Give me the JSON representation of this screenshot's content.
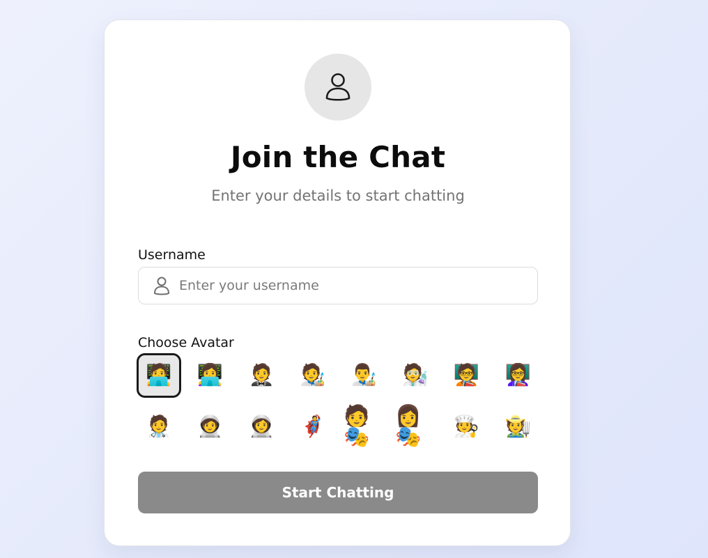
{
  "header": {
    "icon": "user-icon",
    "title": "Join the Chat",
    "subtitle": "Enter your details to start chatting"
  },
  "username": {
    "label": "Username",
    "placeholder": "Enter your username",
    "value": "",
    "icon": "user-icon"
  },
  "avatar_picker": {
    "label": "Choose Avatar",
    "selected_index": 0,
    "avatars": [
      "🧑‍💻",
      "👩‍💻",
      "🤵",
      "🧑‍🎨",
      "👨‍🎨",
      "🧑‍🔬",
      "🧑‍🏫",
      "👩‍🏫",
      "🧑‍⚕️",
      "🧑‍🚀",
      "👩‍🚀",
      "🦸",
      "🧑🎭",
      "👩🎭",
      "🧑‍🍳",
      "🧑‍🌾"
    ]
  },
  "actions": {
    "start_label": "Start Chatting"
  },
  "colors": {
    "button_disabled": "#8a8a8a",
    "selected_border": "#1a1a1a",
    "avatar_circle_bg": "#e6e6e6"
  }
}
